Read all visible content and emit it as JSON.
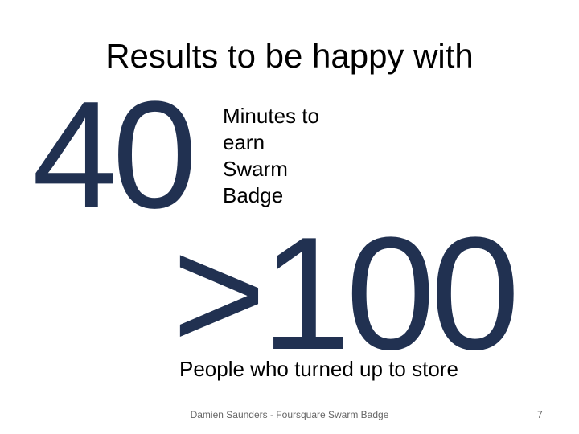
{
  "slide": {
    "title": "Results to be happy with",
    "accent_color": "#213151",
    "stats": [
      {
        "value": "40",
        "caption": "Minutes to earn Swarm Badge"
      },
      {
        "value": ">100",
        "caption": "People who turned up to store"
      }
    ],
    "footer": "Damien Saunders - Foursquare Swarm Badge",
    "page_number": "7"
  }
}
